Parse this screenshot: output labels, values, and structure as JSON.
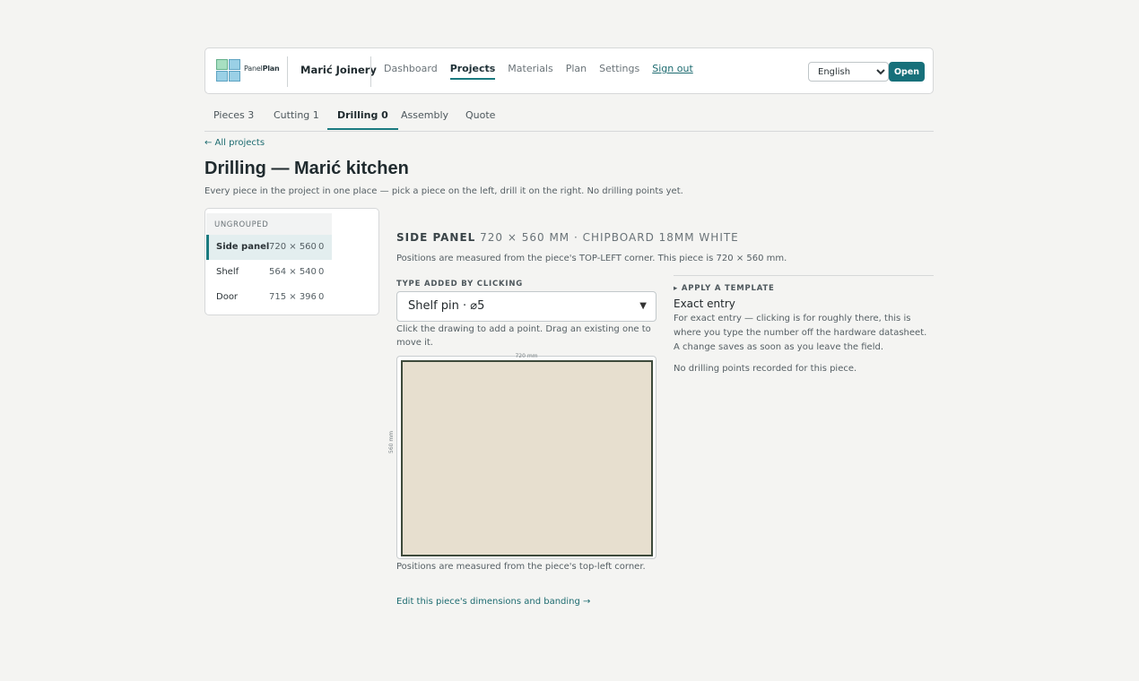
{
  "header": {
    "brand_part1": "Panel",
    "brand_part2": "Plan",
    "business": "Marić Joinery",
    "nav": [
      "Dashboard",
      "Projects",
      "Materials",
      "Plan",
      "Settings"
    ],
    "active_nav": "Projects",
    "sign_out": "Sign out",
    "language": "English",
    "open_label": "Open"
  },
  "tabs": [
    {
      "label": "Pieces 3"
    },
    {
      "label": "Cutting 1"
    },
    {
      "label": "Drilling 0",
      "active": true
    },
    {
      "label": "Assembly"
    },
    {
      "label": "Quote"
    }
  ],
  "back_link": "← All projects",
  "title": "Drilling — Marić kitchen",
  "subtitle": "Every piece in the project in one place — pick a piece on the left, drill it on the right. No drilling points yet.",
  "pieces": {
    "group": "UNGROUPED",
    "items": [
      {
        "name": "Side panel",
        "dims": "720 × 560",
        "count": "0",
        "selected": true
      },
      {
        "name": "Shelf",
        "dims": "564 × 540",
        "count": "0"
      },
      {
        "name": "Door",
        "dims": "715 × 396",
        "count": "0"
      }
    ]
  },
  "detail": {
    "piece_name": "SIDE PANEL",
    "piece_info": "720 × 560 MM · CHIPBOARD 18MM WHITE",
    "measure_note": "Positions are measured from the piece's TOP-LEFT corner. This piece is 720 × 560 mm.",
    "type_label": "TYPE ADDED BY CLICKING",
    "type_value": "Shelf pin · ⌀5",
    "click_help": "Click the drawing to add a point. Drag an existing one to move it.",
    "dim_width": "720 mm",
    "dim_height": "560 mm",
    "canvas_note": "Positions are measured from the piece's top-left corner.",
    "edit_link": "Edit this piece's dimensions and banding →",
    "template_label": "APPLY A TEMPLATE",
    "exact_title": "Exact entry",
    "exact_help": "For exact entry — clicking is for roughly there, this is where you type the number off the hardware datasheet. A change saves as soon as you leave the field.",
    "no_points": "No drilling points recorded for this piece."
  },
  "colors": {
    "accent": "#1a7a7f",
    "board_fill": "#e7dfcf",
    "board_edge": "#3d4a3b"
  }
}
